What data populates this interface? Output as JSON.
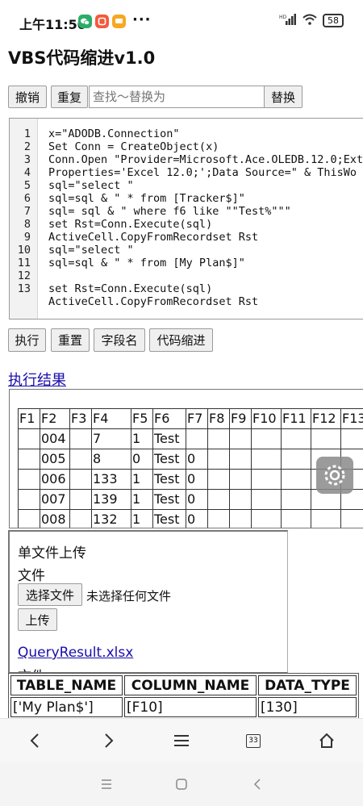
{
  "status_bar": {
    "time": "上午11:50",
    "dots": "···",
    "signal_label": "HD",
    "battery": "58"
  },
  "page_title": "VBS代码缩进v1.0",
  "toolbar": {
    "undo": "撤销",
    "redo": "重复",
    "find_placeholder": "查找～替换为",
    "find_value": "",
    "replace": "替换"
  },
  "editor": {
    "line_numbers": [
      "1",
      "2",
      "3",
      "4",
      "5",
      "6",
      "7",
      "8",
      "9",
      "10",
      "11",
      "12",
      "13"
    ],
    "code": "x=\"ADODB.Connection\"\nSet Conn = CreateObject(x)\nConn.Open \"Provider=Microsoft.Ace.OLEDB.12.0;Ext\nProperties='Excel 12.0;';Data Source=\" & ThisWo\nsql=\"select \"\nsql=sql & \" * from [Tracker$]\"\nsql= sql & \" where f6 like \"\"Test%\"\"\"\nset Rst=Conn.Execute(sql)\nActiveCell.CopyFromRecordset Rst\nsql=\"select \"\nsql=sql & \" * from [My Plan$]\"\n\nset Rst=Conn.Execute(sql)\nActiveCell.CopyFromRecordset Rst"
  },
  "actions": {
    "run": "执行",
    "reset": "重置",
    "field_names": "字段名",
    "indent": "代码缩进"
  },
  "result_link": "执行结果",
  "result_table": {
    "headers": [
      "F1",
      "F2",
      "F3",
      "F4",
      "F5",
      "F6",
      "F7",
      "F8",
      "F9",
      "F10",
      "F11",
      "F12",
      "F13"
    ],
    "rows": [
      [
        "",
        "004",
        "",
        "7",
        "1",
        "Test",
        "",
        "",
        "",
        "",
        "",
        "",
        ""
      ],
      [
        "",
        "005",
        "",
        "8",
        "0",
        "Test",
        "0",
        "",
        "",
        "",
        "",
        "",
        ""
      ],
      [
        "",
        "006",
        "",
        "133",
        "1",
        "Test",
        "0",
        "",
        "",
        "",
        "",
        "",
        ""
      ],
      [
        "",
        "007",
        "",
        "139",
        "1",
        "Test",
        "0",
        "",
        "",
        "",
        "",
        "",
        ""
      ],
      [
        "",
        "008",
        "",
        "132",
        "1",
        "Test",
        "0",
        "",
        "",
        "",
        "",
        "",
        ""
      ]
    ]
  },
  "upload": {
    "title": "单文件上传",
    "file_label": "文件",
    "choose_button": "选择文件",
    "no_file": "未选择任何文件",
    "upload_button": "上传",
    "file_link": "QueryResult.xlsx",
    "partial_text": "文件"
  },
  "meta_table": {
    "headers": [
      "TABLE_NAME",
      "COLUMN_NAME",
      "DATA_TYPE"
    ],
    "rows": [
      [
        "['My Plan$']",
        "[F10]",
        "[130]"
      ]
    ]
  },
  "browser_nav": {
    "tab_count": "33"
  },
  "colors": {
    "link": "#1a0dab",
    "wechat": "#2aae67",
    "app_red": "#f25a3c",
    "app_yellow": "#f7a823"
  }
}
